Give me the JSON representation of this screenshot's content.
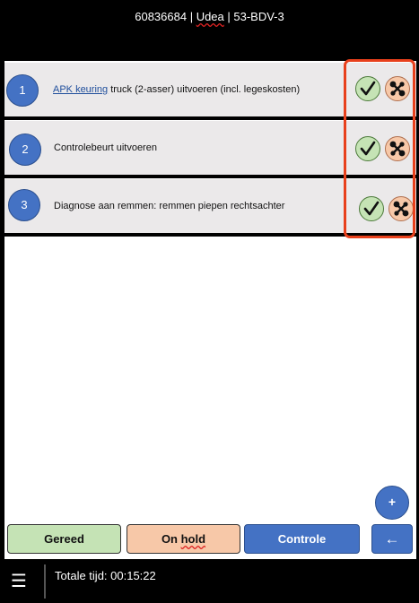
{
  "header": {
    "order_number": "60836684",
    "separator_1": " | ",
    "customer": "Udea",
    "separator_2": " | ",
    "license_plate": "53-BDV-3"
  },
  "tasks": [
    {
      "number": "1",
      "label_prefix": "APK keuring",
      "label_rest": " truck (2-asser) uitvoeren (incl. legeskosten)"
    },
    {
      "number": "2",
      "label": "Controlebeurt uitvoeren"
    },
    {
      "number": "3",
      "label": "Diagnose aan remmen: remmen piepen rechtsachter"
    }
  ],
  "actions": {
    "done_icon": "check-icon",
    "mechanic_icon": "mechanic-icon",
    "highlight_color": "#e8401c"
  },
  "fab": {
    "label": "+"
  },
  "buttons": {
    "gereed": "Gereed",
    "on": "On ",
    "hold": "hold",
    "controle": "Controle",
    "back": "←"
  },
  "footer": {
    "menu": "☰",
    "total_time": "Totale tijd: 00:15:22"
  },
  "colors": {
    "primary_blue": "#4472c4",
    "green": "#c5e3b5",
    "orange": "#f7c8a8",
    "row_bg": "#ebe9ea"
  }
}
